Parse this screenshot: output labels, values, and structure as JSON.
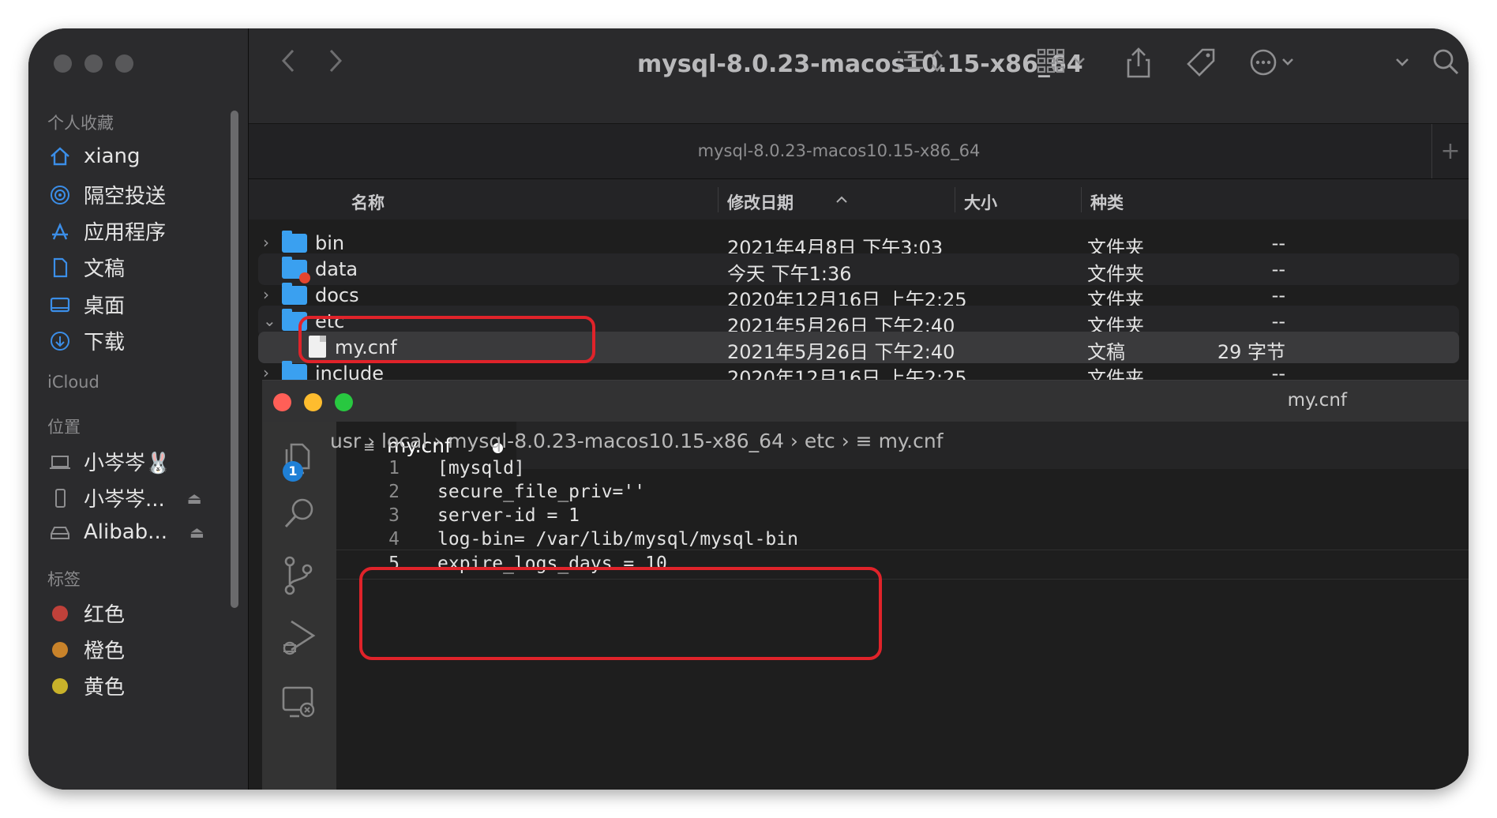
{
  "finder": {
    "title": "mysql-8.0.23-macos10.15-x86_64",
    "tab_title": "mysql-8.0.23-macos10.15-x86_64",
    "tab_plus": "+",
    "columns": {
      "name": "名称",
      "date": "修改日期",
      "size": "大小",
      "kind": "种类"
    },
    "rows": [
      {
        "chevron": "›",
        "name": "bin",
        "date": "2021年4月8日 下午3:03",
        "size": "--",
        "kind": "文件夹"
      },
      {
        "chevron": "",
        "name": "data",
        "date": "今天 下午1:36",
        "size": "--",
        "kind": "文件夹"
      },
      {
        "chevron": "›",
        "name": "docs",
        "date": "2020年12月16日 上午2:25",
        "size": "--",
        "kind": "文件夹"
      },
      {
        "chevron": "⌄",
        "name": "etc",
        "date": "2021年5月26日 下午2:40",
        "size": "--",
        "kind": "文件夹"
      },
      {
        "chevron": "",
        "name": "my.cnf",
        "date": "2021年5月26日 下午2:40",
        "size": "29 字节",
        "kind": "文稿"
      },
      {
        "chevron": "›",
        "name": "include",
        "date": "2020年12月16日 上午2:25",
        "size": "--",
        "kind": "文件夹"
      }
    ]
  },
  "sidebar": {
    "sections": {
      "favorites": "个人收藏",
      "icloud": "iCloud",
      "locations": "位置",
      "tags": "标签"
    },
    "favorites": [
      "xiang",
      "隔空投送",
      "应用程序",
      "文稿",
      "桌面",
      "下载"
    ],
    "locations": [
      "小岑岑🐰",
      "小岑岑...",
      "Alibab..."
    ],
    "tags": [
      {
        "label": "红色",
        "color": "#c0413a"
      },
      {
        "label": "橙色",
        "color": "#c9832a"
      },
      {
        "label": "黄色",
        "color": "#c9b22a"
      }
    ]
  },
  "editor": {
    "window_title": "my.cnf",
    "badge_count": "1",
    "tab_label": "my.cnf",
    "breadcrumb": "usr  ›  local  ›  mysql-8.0.23-macos10.15-x86_64  ›  etc  ›  ≡  my.cnf",
    "lines": [
      {
        "no": "1",
        "text": "[mysqld]"
      },
      {
        "no": "2",
        "text": "secure_file_priv=''"
      },
      {
        "no": "3",
        "text": "server-id = 1"
      },
      {
        "no": "4",
        "text": "log-bin= /var/lib/mysql/mysql-bin"
      },
      {
        "no": "5",
        "text": "expire_logs_days = 10"
      }
    ]
  },
  "colors": {
    "highlight": "#e0232a",
    "folder": "#3aa0f0",
    "badge": "#1f80d6"
  }
}
